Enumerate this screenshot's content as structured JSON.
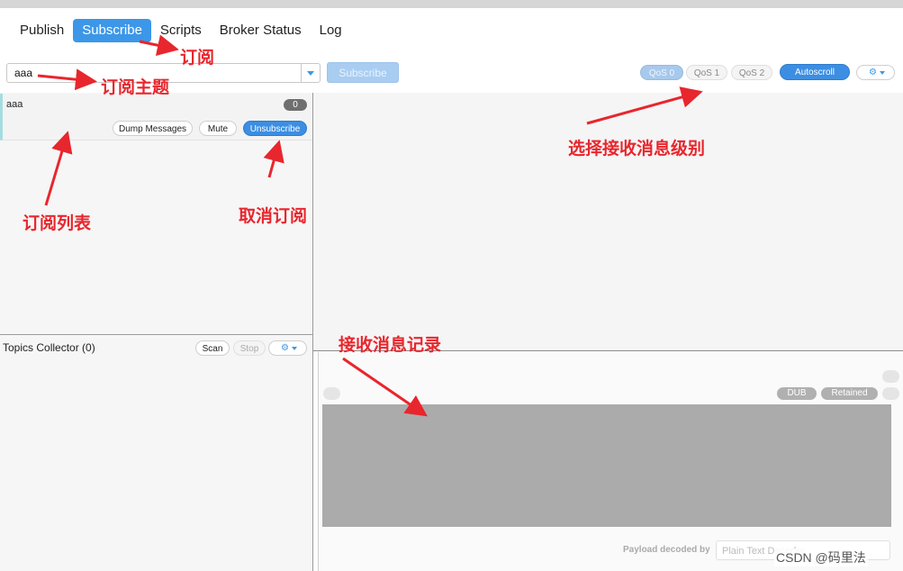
{
  "nav": {
    "tabs": [
      {
        "label": "Publish",
        "active": false
      },
      {
        "label": "Subscribe",
        "active": true
      },
      {
        "label": "Scripts",
        "active": false
      },
      {
        "label": "Broker Status",
        "active": false
      },
      {
        "label": "Log",
        "active": false
      }
    ]
  },
  "subscribe_bar": {
    "topic_value": "aaa",
    "subscribe_label": "Subscribe",
    "qos_options": [
      "QoS 0",
      "QoS 1",
      "QoS 2"
    ],
    "qos_selected": "QoS 0",
    "autoscroll_label": "Autoscroll",
    "settings_icon": "gear-icon"
  },
  "subscriptions": [
    {
      "topic": "aaa",
      "count": "0",
      "dump_label": "Dump Messages",
      "mute_label": "Mute",
      "unsubscribe_label": "Unsubscribe"
    }
  ],
  "topics_collector": {
    "title": "Topics Collector (0)",
    "scan_label": "Scan",
    "stop_label": "Stop"
  },
  "message_detail": {
    "tags": [
      "DUB",
      "Retained"
    ],
    "payload_label": "Payload decoded by",
    "payload_decoder": "Plain Text Decoder"
  },
  "annotations": {
    "subscribe": "订阅",
    "topic": "订阅主题",
    "qos": "选择接收消息级别",
    "list": "订阅列表",
    "unsubscribe": "取消订阅",
    "records": "接收消息记录"
  },
  "watermark": "CSDN @码里法",
  "colors": {
    "accent": "#3c97e8",
    "annotation": "#e8262d"
  }
}
